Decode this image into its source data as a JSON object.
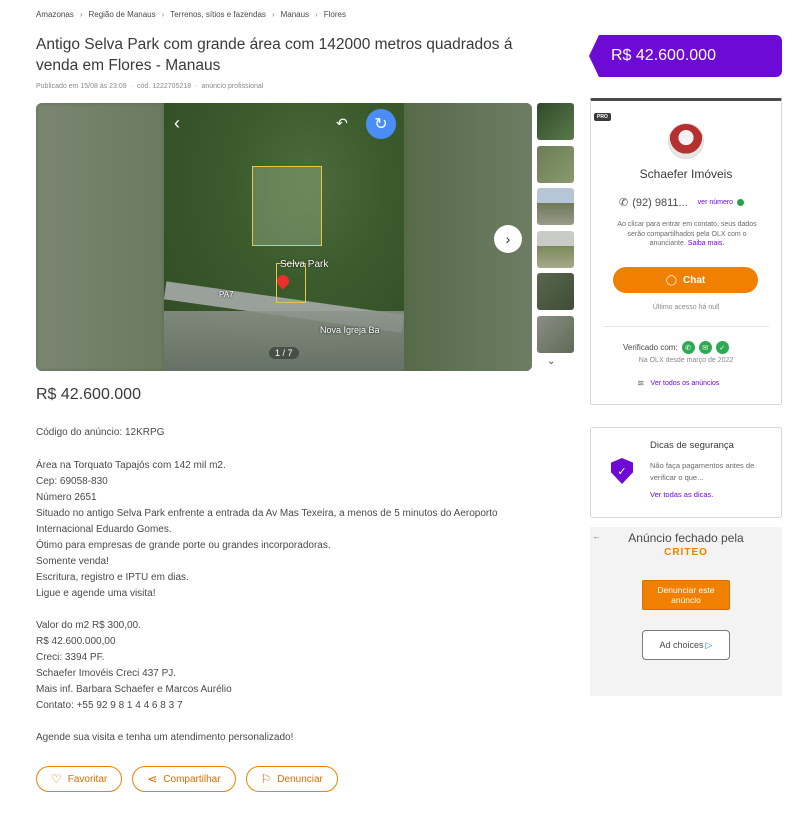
{
  "breadcrumb": [
    "Amazonas",
    "Região de Manaus",
    "Terrenos, sítios e fazendas",
    "Manaus",
    "Flores"
  ],
  "title": "Antigo Selva Park com grande área com 142000 metros quadrados á venda em Flores - Manaus",
  "meta": {
    "published": "Publicado em 15/08 às 23:09",
    "code": "cód. 1222705218",
    "type": "anúncio profissional"
  },
  "price_tag": "R$ 42.600.000",
  "gallery": {
    "counter": "1 / 7",
    "map_label_1": "Selva Park",
    "map_label_2": "PA7",
    "map_label_3": "Nova Igreja Ba",
    "thumbnail_colors": [
      "#3f5a3a",
      "#6b7d57",
      "#8d9a89",
      "#a7a88a",
      "#59664f",
      "#8a8f85"
    ]
  },
  "body_price": "R$ 42.600.000",
  "ad_code": "Código do anúncio: 12KRPG",
  "description": [
    "Área na Torquato Tapajós com 142 mil m2.",
    "Cep: 69058-830",
    "Número 2651",
    "Situado no antigo Selva Park enfrente a entrada da Av Mas Texeira, a menos de 5 minutos do Aeroporto",
    "Internacional Eduardo Gomes.",
    "Ótimo para empresas de grande porte ou grandes incorporadoras.",
    "Somente venda!",
    "Escritura, registro e IPTU em dias.",
    "Ligue e agende uma visita!",
    "",
    "Valor do m2 R$ 300,00.",
    "R$ 42.600.000,00",
    "Creci: 3394 PF.",
    "Schaefer Imovéis Creci 437 PJ.",
    "Mais inf. Barbara Schaefer e Marcos Aurélio",
    "Contato: +55 92 9 8 1 4 4 6 8 3 7",
    "",
    "Agende sua visita e tenha um atendimento personalizado!"
  ],
  "actions": {
    "favorite": "Favoritar",
    "share": "Compartilhar",
    "report": "Denunciar"
  },
  "seller": {
    "badge": "PRO",
    "name": "Schaefer Imóveis",
    "phone": "(92) 9811...",
    "show_number": "ver número",
    "disclaimer": "Ao clicar para entrar em contato, seus dados serão compartilhados pela OLX com o anunciante.",
    "learn_more": "Saiba mais.",
    "chat": "Chat",
    "last_access": "Último acesso há null",
    "verified": "Verificado com:",
    "since": "Na OLX desde março de 2022",
    "all_ads": "Ver todos os anúncios"
  },
  "safety": {
    "title": "Dicas de segurança",
    "text": "Não faça pagamentos antes de verificar o que...",
    "link": "Ver todas as dicas."
  },
  "ad_box": {
    "closed": "Anúncio fechado pela",
    "brand": "CRITEO",
    "report": "Denunciar este anúncio",
    "choices": "Ad choices"
  },
  "colors": {
    "brand_purple": "#6e0ad6",
    "brand_orange": "#f28000"
  }
}
